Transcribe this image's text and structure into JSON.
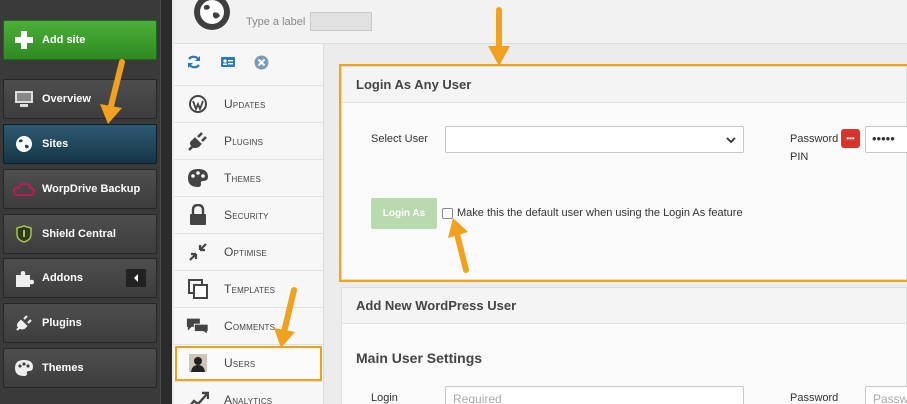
{
  "colors": {
    "accent": "#f0a11e",
    "add_green": "#3a9b2c",
    "active_blue": "#1f4659",
    "pin_red": "#d9342b"
  },
  "sidebar": {
    "items": [
      {
        "label": "Add site",
        "icon": "plus-icon"
      },
      {
        "label": "Overview",
        "icon": "monitor-icon"
      },
      {
        "label": "Sites",
        "icon": "globe-icon"
      },
      {
        "label": "WorpDrive Backup",
        "icon": "cloud-icon"
      },
      {
        "label": "Shield Central",
        "icon": "shield-icon"
      },
      {
        "label": "Addons",
        "icon": "puzzle-icon"
      },
      {
        "label": "Plugins",
        "icon": "plug-icon"
      },
      {
        "label": "Themes",
        "icon": "palette-icon"
      }
    ]
  },
  "header": {
    "label_prompt": "Type a label"
  },
  "subnav": {
    "items": [
      {
        "label": "Updates",
        "icon": "wordpress-icon"
      },
      {
        "label": "Plugins",
        "icon": "plug-icon"
      },
      {
        "label": "Themes",
        "icon": "palette-icon"
      },
      {
        "label": "Security",
        "icon": "lock-icon"
      },
      {
        "label": "Optimise",
        "icon": "compress-icon"
      },
      {
        "label": "Templates",
        "icon": "templates-icon"
      },
      {
        "label": "Comments",
        "icon": "comments-icon"
      },
      {
        "label": "Users",
        "icon": "user-icon"
      },
      {
        "label": "Analytics",
        "icon": "analytics-icon"
      }
    ]
  },
  "login_panel": {
    "title": "Login As Any User",
    "select_user_label": "Select User",
    "select_user_value": "",
    "password_pin_label_1": "Password",
    "password_pin_label_2": "PIN",
    "pin_value": "•••••",
    "login_button": "Login As",
    "default_checkbox_label": "Make this the default user when using the Login As feature"
  },
  "add_user_panel": {
    "title": "Add New WordPress User",
    "section_title": "Main User Settings",
    "login_label": "Login",
    "login_placeholder": "Required",
    "password_label": "Password",
    "password_placeholder": "Passw"
  }
}
